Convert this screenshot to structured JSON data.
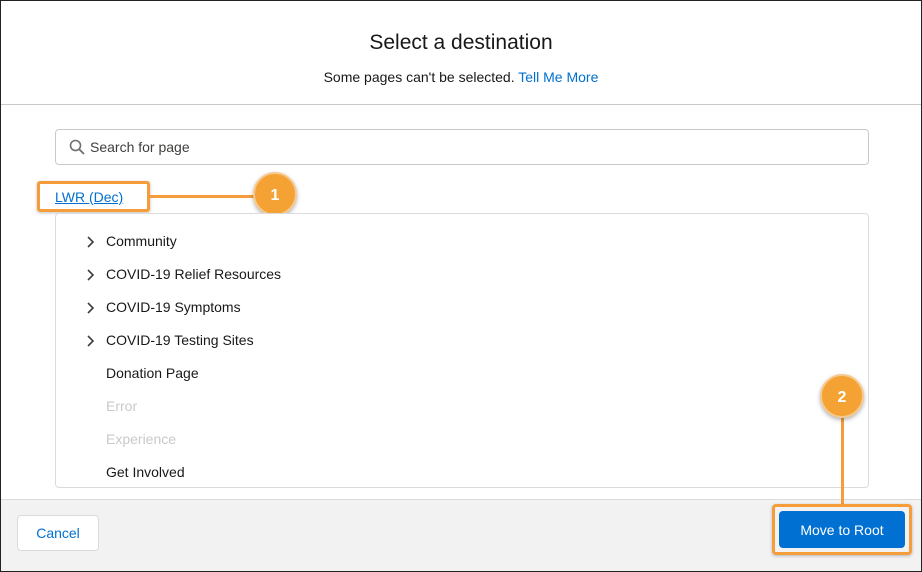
{
  "header": {
    "title": "Select a destination",
    "subtitle_text": "Some pages can't be selected. ",
    "help_link": "Tell Me More"
  },
  "search": {
    "placeholder": "Search for page",
    "value": ""
  },
  "root": {
    "label": "LWR (Dec)"
  },
  "tree": {
    "items": [
      {
        "label": "Community",
        "expandable": true,
        "disabled": false
      },
      {
        "label": "COVID-19 Relief Resources",
        "expandable": true,
        "disabled": false
      },
      {
        "label": "COVID-19 Symptoms",
        "expandable": true,
        "disabled": false
      },
      {
        "label": "COVID-19 Testing Sites",
        "expandable": true,
        "disabled": false
      },
      {
        "label": "Donation Page",
        "expandable": false,
        "disabled": false
      },
      {
        "label": "Error",
        "expandable": false,
        "disabled": true
      },
      {
        "label": "Experience",
        "expandable": false,
        "disabled": true
      },
      {
        "label": "Get Involved",
        "expandable": false,
        "disabled": false
      }
    ]
  },
  "callouts": {
    "one": "1",
    "two": "2"
  },
  "footer": {
    "cancel_label": "Cancel",
    "primary_label": "Move to Root"
  },
  "colors": {
    "brand": "#0070d2",
    "callout": "#f4a233",
    "disabled_text": "#c9c9c9"
  }
}
